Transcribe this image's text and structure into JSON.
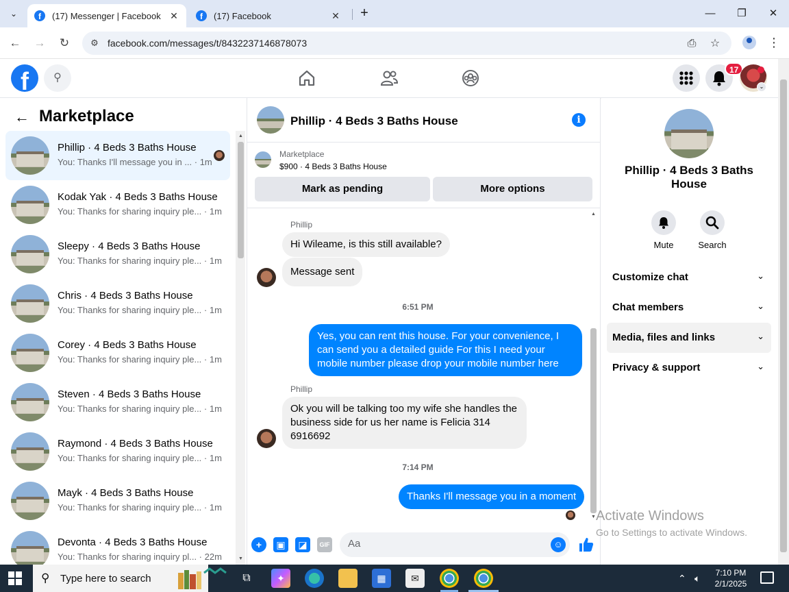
{
  "browser": {
    "tabs": [
      {
        "title": "(17) Messenger | Facebook",
        "active": true
      },
      {
        "title": "(17) Facebook",
        "active": false
      }
    ],
    "url": "facebook.com/messages/t/8432237146878073"
  },
  "fb_header": {
    "notification_count": "17"
  },
  "sidebar": {
    "title": "Marketplace",
    "conversations": [
      {
        "name": "Phillip · 4 Beds 3 Baths House",
        "snippet": "You: Thanks I'll message you in ... · 1m",
        "active": true
      },
      {
        "name": "Kodak Yak · 4 Beds 3 Baths House",
        "snippet": "You: Thanks for sharing inquiry ple... · 1m"
      },
      {
        "name": "Sleepy · 4 Beds 3 Baths House",
        "snippet": "You: Thanks for sharing inquiry ple... · 1m"
      },
      {
        "name": "Chris · 4 Beds 3 Baths House",
        "snippet": "You: Thanks for sharing inquiry ple... · 1m"
      },
      {
        "name": "Corey · 4 Beds 3 Baths House",
        "snippet": "You: Thanks for sharing inquiry ple... · 1m"
      },
      {
        "name": "Steven · 4 Beds 3 Baths House",
        "snippet": "You: Thanks for sharing inquiry ple... · 1m"
      },
      {
        "name": "Raymond · 4 Beds 3 Baths House",
        "snippet": "You: Thanks for sharing inquiry ple... · 1m"
      },
      {
        "name": "Mayk · 4 Beds 3 Baths House",
        "snippet": "You: Thanks for sharing inquiry ple... · 1m"
      },
      {
        "name": "Devonta · 4 Beds 3 Baths House",
        "snippet": "You: Thanks for sharing inquiry pl... · 22m"
      }
    ]
  },
  "chat": {
    "title": "Phillip · 4 Beds 3 Baths House",
    "listing_category": "Marketplace",
    "listing_price": "$900 · 4 Beds 3 Baths House",
    "mark_pending_label": "Mark as pending",
    "more_options_label": "More options",
    "sender_name": "Phillip",
    "msg1": "Hi Wileame, is this still available?",
    "msg2": "Message sent",
    "time1": "6:51 PM",
    "msg3": "Yes, you can rent this house. For your convenience, I can send you a detailed guide For this I need your mobile number please drop your mobile number here",
    "sender_name2": "Phillip",
    "msg4": "Ok you will be talking too my wife she handles the business side for us her name is Felicia 314 6916692",
    "time2": "7:14 PM",
    "msg5": "Thanks I'll message you in a moment",
    "composer_placeholder": "Aa"
  },
  "details": {
    "name": "Phillip · 4 Beds 3 Baths House",
    "mute_label": "Mute",
    "search_label": "Search",
    "sections": [
      "Customize chat",
      "Chat members",
      "Media, files and links",
      "Privacy & support"
    ]
  },
  "watermark": {
    "line1": "Activate Windows",
    "line2": "Go to Settings to activate Windows."
  },
  "taskbar": {
    "search_placeholder": "Type here to search",
    "time": "7:10 PM",
    "date": "2/1/2025"
  }
}
